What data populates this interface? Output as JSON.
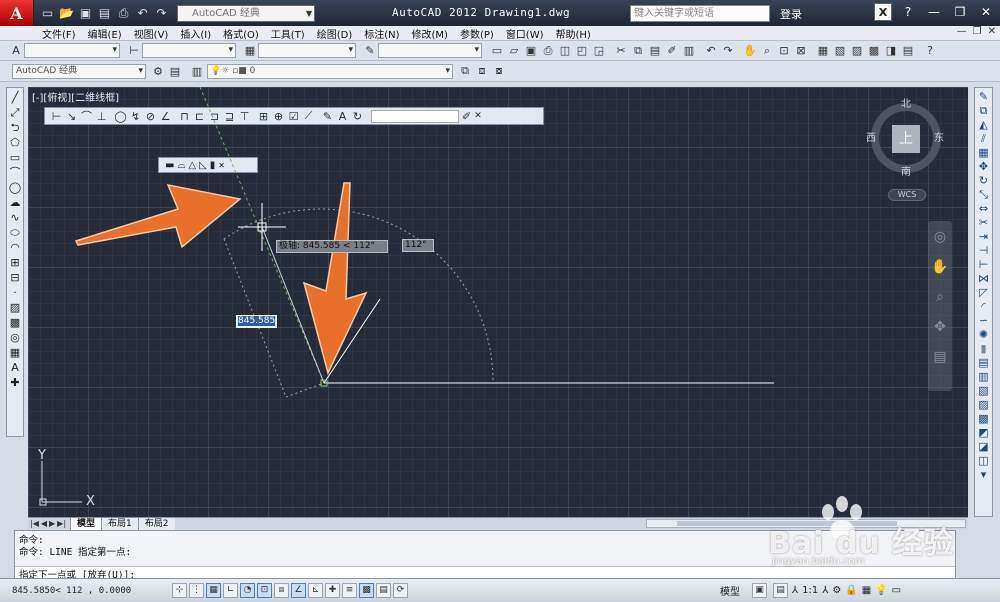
{
  "titlebar": {
    "app_logo": "A",
    "workspace": "AutoCAD 经典",
    "title": "AutoCAD 2012    Drawing1.dwg",
    "search_placeholder": "键入关键字或短语",
    "login": "登录",
    "help": "?"
  },
  "menubar": {
    "items": [
      "文件(F)",
      "编辑(E)",
      "视图(V)",
      "插入(I)",
      "格式(O)",
      "工具(T)",
      "绘图(D)",
      "标注(N)",
      "修改(M)",
      "参数(P)",
      "窗口(W)",
      "帮助(H)"
    ]
  },
  "toolbar2": {
    "workspace": "AutoCAD 经典",
    "layer": "0"
  },
  "canvas": {
    "viewport_label": "[-][俯视][二维线框]",
    "polar_tooltip": "极轴: 845.585 < 112°",
    "angle_tooltip": "112°",
    "length_input": "845.585",
    "compass": {
      "north": "北",
      "south": "南",
      "east": "东",
      "west": "西",
      "face": "上"
    },
    "wcs": "WCS",
    "ucs_x": "X",
    "ucs_y": "Y"
  },
  "tabs": [
    "模型",
    "布局1",
    "布局2"
  ],
  "command": {
    "history": [
      "命令:",
      "命令:  LINE 指定第一点:"
    ],
    "prompt": "指定下一点或 [放弃(U)]:"
  },
  "status": {
    "coords": "845.5850< 112    , 0.0000",
    "model": "模型",
    "scale": "1:1"
  },
  "watermark": {
    "brand": "Bai du 经验",
    "url": "jingyan.baidu.com"
  },
  "colors": {
    "canvas_bg": "#252b38",
    "arrow": "#e8702a",
    "line": "#ffffff",
    "tracking": "#7fbf5f"
  }
}
